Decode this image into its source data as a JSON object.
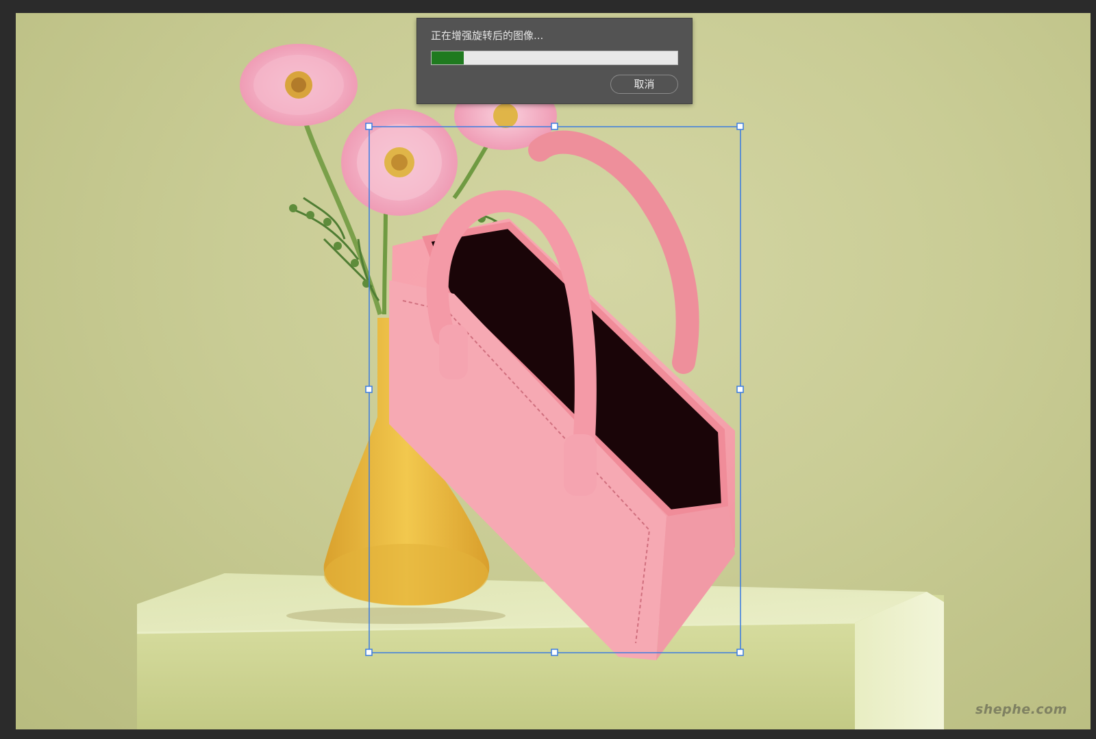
{
  "dialog": {
    "message": "正在增强旋转后的图像...",
    "progress": 0.13,
    "cancel_label": "取消"
  },
  "canvas": {
    "watermark": "shephe.com"
  },
  "colors": {
    "dialog_bg": "#535353",
    "progress_fill": "#1f7a1f",
    "selection": "#3a7be0",
    "bag": "#f4a0aa",
    "vase": "#e8bc45",
    "background": "#c9cc95"
  },
  "icons": {
    "transform_handle": "square-handle"
  }
}
